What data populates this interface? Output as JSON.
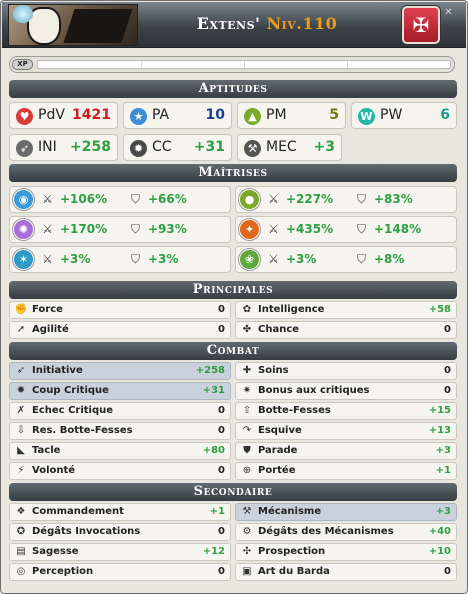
{
  "header": {
    "name": "Extens'",
    "level": "Niv.110",
    "close_label": "✕"
  },
  "xp": {
    "badge": "XP",
    "progress": 0
  },
  "sections": {
    "aptitudes": "Aptitudes",
    "maitrises": "Maîtrises",
    "principales": "Principales",
    "combat": "Combat",
    "secondaire": "Secondaire"
  },
  "aptitudes": [
    {
      "label": "PdV",
      "value": "1421",
      "value_color": "#c81e1e",
      "icon": "heart-icon",
      "icon_color": "#d93a3a"
    },
    {
      "label": "PA",
      "value": "10",
      "value_color": "#1a3f9a",
      "icon": "star-icon",
      "icon_color": "#3a8fd6"
    },
    {
      "label": "PM",
      "value": "5",
      "value_color": "#6b7d10",
      "icon": "boot-icon",
      "icon_color": "#7bab2a"
    },
    {
      "label": "PW",
      "value": "6",
      "value_color": "#1a9a8a",
      "icon": "wakfu-icon",
      "icon_color": "#22b7a6"
    },
    {
      "label": "INI",
      "value": "+258",
      "value_color": "#2f9e44",
      "icon": "initiative-icon",
      "icon_color": "#6b6b6b"
    },
    {
      "label": "CC",
      "value": "+31",
      "value_color": "#2f9e44",
      "icon": "critical-icon",
      "icon_color": "#4a4a4a"
    },
    {
      "label": "MEC",
      "value": "+3",
      "value_color": "#2f9e44",
      "icon": "mechanism-icon",
      "icon_color": "#555555"
    }
  ],
  "maitrises": [
    {
      "element": "water-icon",
      "color": "#3d9ad8",
      "attack": "+106%",
      "resist": "+66%"
    },
    {
      "element": "earth-icon",
      "color": "#7da82a",
      "attack": "+227%",
      "resist": "+83%"
    },
    {
      "element": "air-icon",
      "color": "#a76ed8",
      "attack": "+170%",
      "resist": "+93%"
    },
    {
      "element": "fire-icon",
      "color": "#e06a1a",
      "attack": "+435%",
      "resist": "+148%"
    },
    {
      "element": "stasis-icon",
      "color": "#2f9bc6",
      "attack": "+3%",
      "resist": "+3%"
    },
    {
      "element": "nature-icon",
      "color": "#5ea83a",
      "attack": "+3%",
      "resist": "+8%"
    }
  ],
  "principales": [
    {
      "label": "Force",
      "value": "0",
      "icon": "fist-icon"
    },
    {
      "label": "Intelligence",
      "value": "+58",
      "icon": "brain-icon"
    },
    {
      "label": "Agilité",
      "value": "0",
      "icon": "running-icon"
    },
    {
      "label": "Chance",
      "value": "0",
      "icon": "clover-icon"
    }
  ],
  "combat": [
    {
      "label": "Initiative",
      "value": "+258",
      "icon": "initiative-icon",
      "highlight": true
    },
    {
      "label": "Soins",
      "value": "0",
      "icon": "heal-icon"
    },
    {
      "label": "Coup Critique",
      "value": "+31",
      "icon": "critical-icon",
      "highlight": true
    },
    {
      "label": "Bonus aux critiques",
      "value": "0",
      "icon": "critical-bonus-icon"
    },
    {
      "label": "Echec Critique",
      "value": "0",
      "icon": "critical-fail-icon"
    },
    {
      "label": "Botte-Fesses",
      "value": "+15",
      "icon": "kick-icon"
    },
    {
      "label": "Res. Botte-Fesses",
      "value": "0",
      "icon": "kick-resist-icon"
    },
    {
      "label": "Esquive",
      "value": "+13",
      "icon": "dodge-icon"
    },
    {
      "label": "Tacle",
      "value": "+80",
      "icon": "tackle-icon"
    },
    {
      "label": "Parade",
      "value": "+3",
      "icon": "parry-icon"
    },
    {
      "label": "Volonté",
      "value": "0",
      "icon": "willpower-icon"
    },
    {
      "label": "Portée",
      "value": "+1",
      "icon": "range-icon"
    }
  ],
  "secondaire": [
    {
      "label": "Commandement",
      "value": "+1",
      "icon": "paw-icon"
    },
    {
      "label": "Mécanisme",
      "value": "+3",
      "icon": "mechanism-icon",
      "highlight": true
    },
    {
      "label": "Dégâts Invocations",
      "value": "0",
      "icon": "summon-damage-icon"
    },
    {
      "label": "Dégâts des Mécanismes",
      "value": "+40",
      "icon": "mechanism-damage-icon"
    },
    {
      "label": "Sagesse",
      "value": "+12",
      "icon": "book-icon"
    },
    {
      "label": "Prospection",
      "value": "+10",
      "icon": "prospection-icon"
    },
    {
      "label": "Perception",
      "value": "0",
      "icon": "perception-icon"
    },
    {
      "label": "Art du Barda",
      "value": "0",
      "icon": "bag-icon"
    }
  ]
}
